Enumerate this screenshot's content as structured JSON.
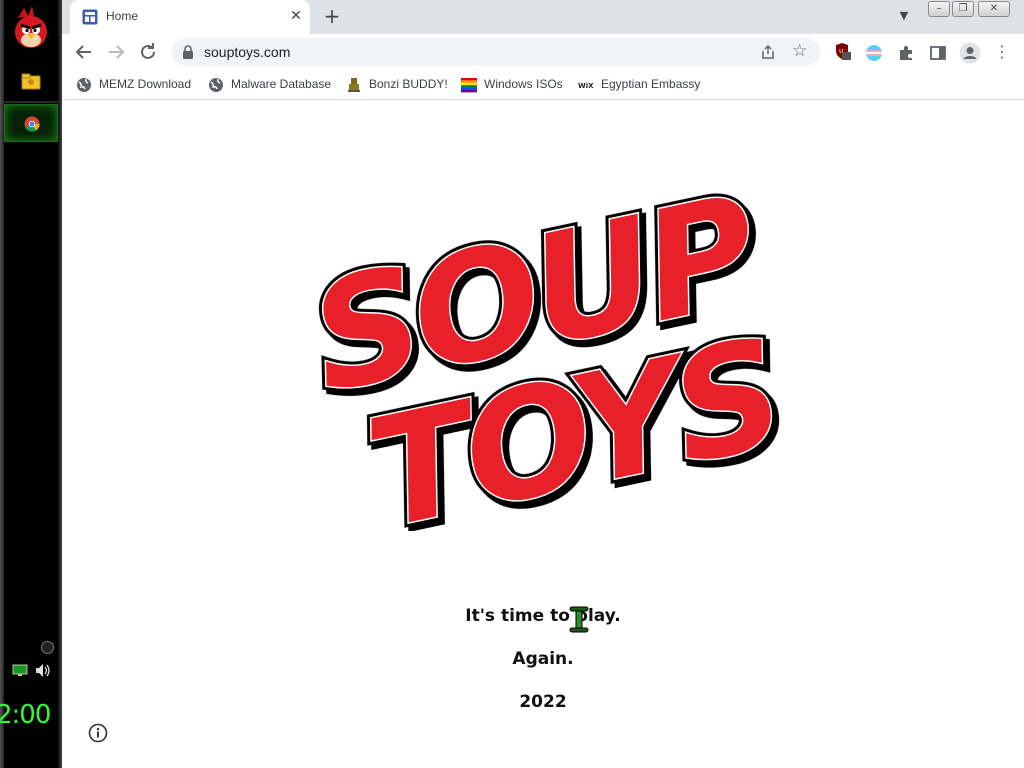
{
  "taskbar": {
    "clock": "2:00",
    "items": [
      "angry-bird-start",
      "folder",
      "chrome"
    ]
  },
  "browser": {
    "tab": {
      "title": "Home"
    },
    "address": {
      "url": "souptoys.com"
    },
    "bookmarks": [
      {
        "label": "MEMZ Download",
        "icon": "globe-icon"
      },
      {
        "label": "Malware Database",
        "icon": "globe-icon"
      },
      {
        "label": "Bonzi BUDDY!",
        "icon": "bonzi-icon"
      },
      {
        "label": "Windows ISOs",
        "icon": "rainbow-flag-icon"
      },
      {
        "label": "Egyptian Embassy",
        "icon": "wix-icon"
      }
    ],
    "extension_badge": "1"
  },
  "page": {
    "logo_text": [
      "SOUP",
      "TOYS"
    ],
    "lines": [
      "It's time to play.",
      "Again.",
      "2022"
    ]
  },
  "colors": {
    "logo_red": "#e8202a",
    "clock_green": "#2bff2b",
    "tabstrip": "#dee1e6"
  }
}
